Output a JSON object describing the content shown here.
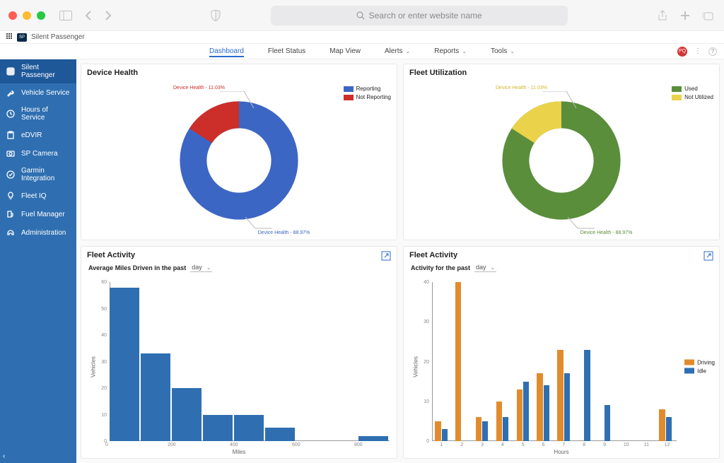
{
  "browser": {
    "search_placeholder": "Search or enter website name",
    "tab_title": "Silent Passenger"
  },
  "topnav": {
    "items": [
      "Dashboard",
      "Fleet Status",
      "Map View",
      "Alerts",
      "Reports",
      "Tools"
    ],
    "active_index": 0,
    "avatar_initials": "PQ"
  },
  "sidebar": {
    "items": [
      {
        "label": "Silent Passenger",
        "icon": "app-icon"
      },
      {
        "label": "Vehicle Service",
        "icon": "wrench-icon"
      },
      {
        "label": "Hours of Service",
        "icon": "clock-icon"
      },
      {
        "label": "eDVIR",
        "icon": "clipboard-icon"
      },
      {
        "label": "SP Camera",
        "icon": "camera-icon"
      },
      {
        "label": "Garmin Integration",
        "icon": "check-circle-icon"
      },
      {
        "label": "Fleet IQ",
        "icon": "lightbulb-icon"
      },
      {
        "label": "Fuel Manager",
        "icon": "fuel-icon"
      },
      {
        "label": "Administration",
        "icon": "headset-icon"
      }
    ],
    "active_index": 0
  },
  "panels": {
    "device_health": {
      "title": "Device Health",
      "legend": [
        {
          "label": "Reporting",
          "color": "#3c66c4"
        },
        {
          "label": "Not Reporting",
          "color": "#cc2e2a"
        }
      ],
      "label_minor": "Device Health - 11.03%",
      "label_major": "Device Health - 88.97%"
    },
    "fleet_utilization": {
      "title": "Fleet Utilization",
      "legend": [
        {
          "label": "Used",
          "color": "#5a8e3b"
        },
        {
          "label": "Not Utilized",
          "color": "#ead24a"
        }
      ],
      "label_minor": "Device Health - 11.03%",
      "label_major": "Device Health - 88.97%"
    },
    "avg_miles": {
      "title": "Fleet Activity",
      "subtitle_prefix": "Average Miles Driven in the past",
      "period_selected": "day",
      "xlabel": "Miles",
      "ylabel": "Vehicles"
    },
    "activity_hours": {
      "title": "Fleet Activity",
      "subtitle_prefix": "Activity for the past",
      "period_selected": "day",
      "xlabel": "Hours",
      "ylabel": "Vehicles",
      "legend": [
        {
          "label": "Driving",
          "color": "#e28b2d"
        },
        {
          "label": "Idle",
          "color": "#2f6fb1"
        }
      ]
    }
  },
  "colors": {
    "blue": "#3c66c4",
    "blue2": "#2f6fb1",
    "red": "#cc2e2a",
    "green": "#5a8e3b",
    "yellow": "#ead24a",
    "orange": "#e28b2d"
  },
  "chart_data": [
    {
      "name": "device_health",
      "type": "pie",
      "title": "Device Health",
      "series": [
        {
          "name": "Reporting",
          "value": 88.97,
          "color": "#3c66c4"
        },
        {
          "name": "Not Reporting",
          "value": 11.03,
          "color": "#cc2e2a"
        }
      ]
    },
    {
      "name": "fleet_utilization",
      "type": "pie",
      "title": "Fleet Utilization",
      "series": [
        {
          "name": "Used",
          "value": 88.97,
          "color": "#5a8e3b"
        },
        {
          "name": "Not Utilized",
          "value": 11.03,
          "color": "#ead24a"
        }
      ]
    },
    {
      "name": "avg_miles_driven",
      "type": "bar",
      "title": "Average Miles Driven in the past day",
      "xlabel": "Miles",
      "ylabel": "Vehicles",
      "xlim": [
        0,
        900
      ],
      "ylim": [
        0,
        60
      ],
      "x": [
        0,
        100,
        200,
        300,
        400,
        500,
        600,
        700,
        800
      ],
      "values": [
        58,
        33,
        20,
        10,
        10,
        5,
        0,
        0,
        2
      ]
    },
    {
      "name": "activity_hours",
      "type": "bar",
      "title": "Activity for the past day",
      "xlabel": "Hours",
      "ylabel": "Vehicles",
      "ylim": [
        0,
        40
      ],
      "categories": [
        "1",
        "2",
        "3",
        "4",
        "5",
        "6",
        "7",
        "8",
        "9",
        "10",
        "11",
        "12"
      ],
      "series": [
        {
          "name": "Driving",
          "color": "#e28b2d",
          "values": [
            5,
            40,
            6,
            10,
            13,
            17,
            23,
            0,
            0,
            0,
            0,
            8
          ]
        },
        {
          "name": "Idle",
          "color": "#2f6fb1",
          "values": [
            3,
            0,
            5,
            6,
            15,
            14,
            17,
            23,
            9,
            0,
            0,
            6
          ]
        }
      ]
    }
  ]
}
